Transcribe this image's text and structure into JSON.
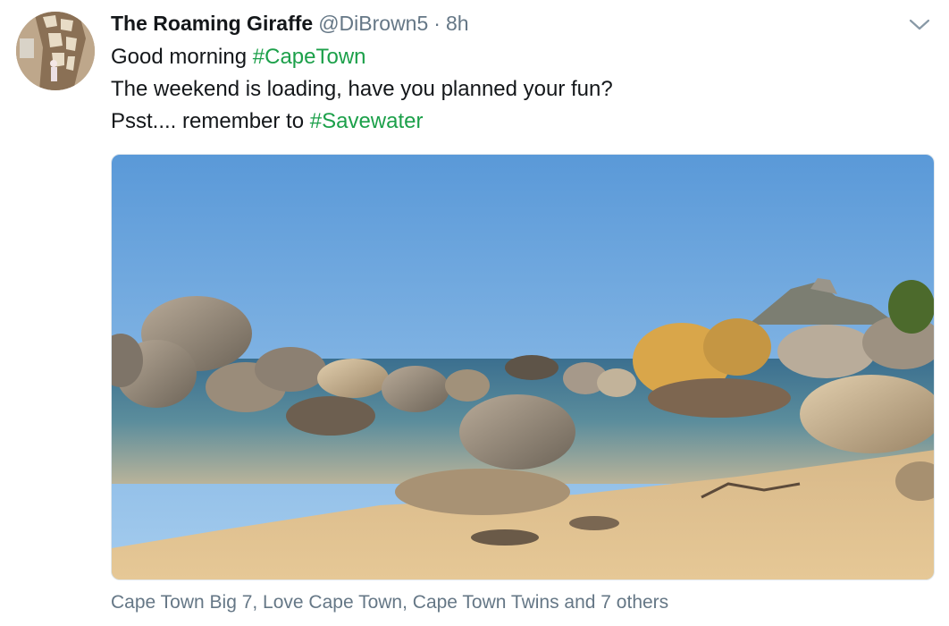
{
  "tweet": {
    "display_name": "The Roaming Giraffe",
    "handle": "@DiBrown5",
    "separator": "·",
    "time": "8h",
    "lines": [
      {
        "text": "Good morning ",
        "hashtag": "#CapeTown"
      },
      {
        "text": "The weekend is loading, have you planned your fun?",
        "hashtag": ""
      },
      {
        "text": "Psst.... remember to ",
        "hashtag": "#Savewater"
      }
    ],
    "tagged_users": "Cape Town Big 7, Love Cape Town, Cape Town Twins and 7 others"
  },
  "icons": {
    "menu": "chevron-down-icon",
    "avatar": "giraffe-avatar"
  },
  "colors": {
    "hashtag": "#1ca04a",
    "meta": "#657786",
    "text": "#14171a"
  }
}
